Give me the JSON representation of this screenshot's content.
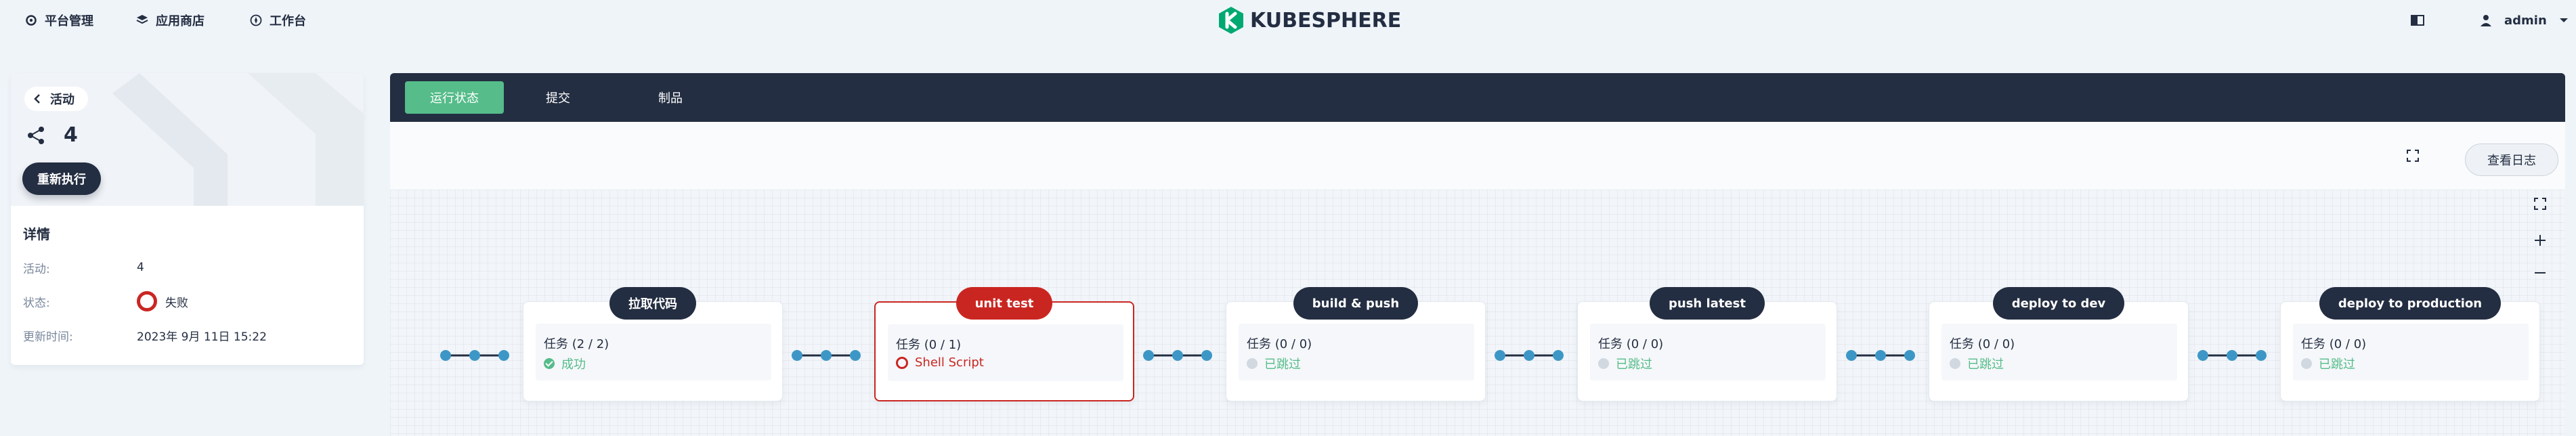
{
  "nav": {
    "platform": "平台管理",
    "app_store": "应用商店",
    "workbench": "工作台",
    "logo_text": "KUBESPHERE",
    "user": "admin"
  },
  "left": {
    "back_label": "活动",
    "run_number": "4",
    "rerun_label": "重新执行",
    "details_title": "详情",
    "details": [
      {
        "key": "活动:",
        "value": "4"
      },
      {
        "key": "状态:",
        "value": "失败"
      },
      {
        "key": "更新时间:",
        "value": "2023年 9月 11日 15:22"
      }
    ]
  },
  "tabs": [
    "运行状态",
    "提交",
    "制品"
  ],
  "toolbar": {
    "logs_label": "查看日志"
  },
  "stages": [
    {
      "name": "拉取代码",
      "tasks": "任务 (2 / 2)",
      "status": "成功",
      "state": "success"
    },
    {
      "name": "unit test",
      "tasks": "任务 (0 / 1)",
      "status": "Shell Script",
      "state": "failed"
    },
    {
      "name": "build & push",
      "tasks": "任务 (0 / 0)",
      "status": "已跳过",
      "state": "skipped"
    },
    {
      "name": "push latest",
      "tasks": "任务 (0 / 0)",
      "status": "已跳过",
      "state": "skipped"
    },
    {
      "name": "deploy to dev",
      "tasks": "任务 (0 / 0)",
      "status": "已跳过",
      "state": "skipped"
    },
    {
      "name": "deploy to production",
      "tasks": "任务 (0 / 0)",
      "status": "已跳过",
      "state": "skipped"
    }
  ],
  "colors": {
    "success": "#55bc8a",
    "failed": "#ca2621",
    "dark": "#242e42",
    "connector": "#3d97c6"
  }
}
